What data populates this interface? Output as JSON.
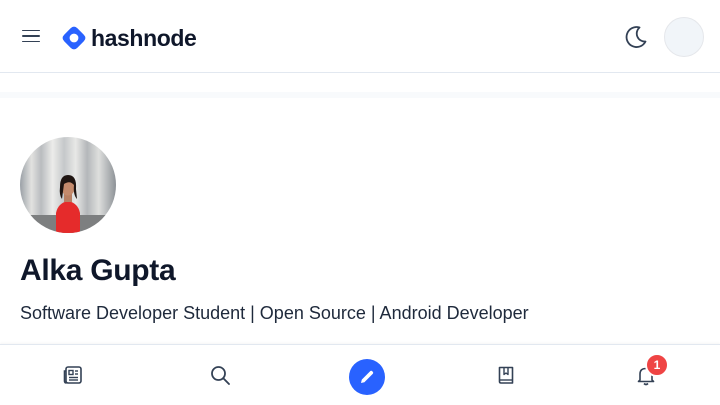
{
  "header": {
    "logo_text": "hashnode",
    "menu_icon": "hamburger-menu-icon",
    "theme_icon": "moon-icon",
    "brand_color": "#2962ff"
  },
  "profile": {
    "name": "Alka Gupta",
    "tagline": "Software Developer Student | Open Source | Android Developer",
    "photo": "profile-photo"
  },
  "bottom_nav": {
    "items": [
      {
        "icon": "feed-icon"
      },
      {
        "icon": "search-icon"
      },
      {
        "icon": "pencil-icon"
      },
      {
        "icon": "bookmark-icon"
      },
      {
        "icon": "bell-icon"
      }
    ],
    "notification_count": "1",
    "badge_color": "#ef4444"
  }
}
